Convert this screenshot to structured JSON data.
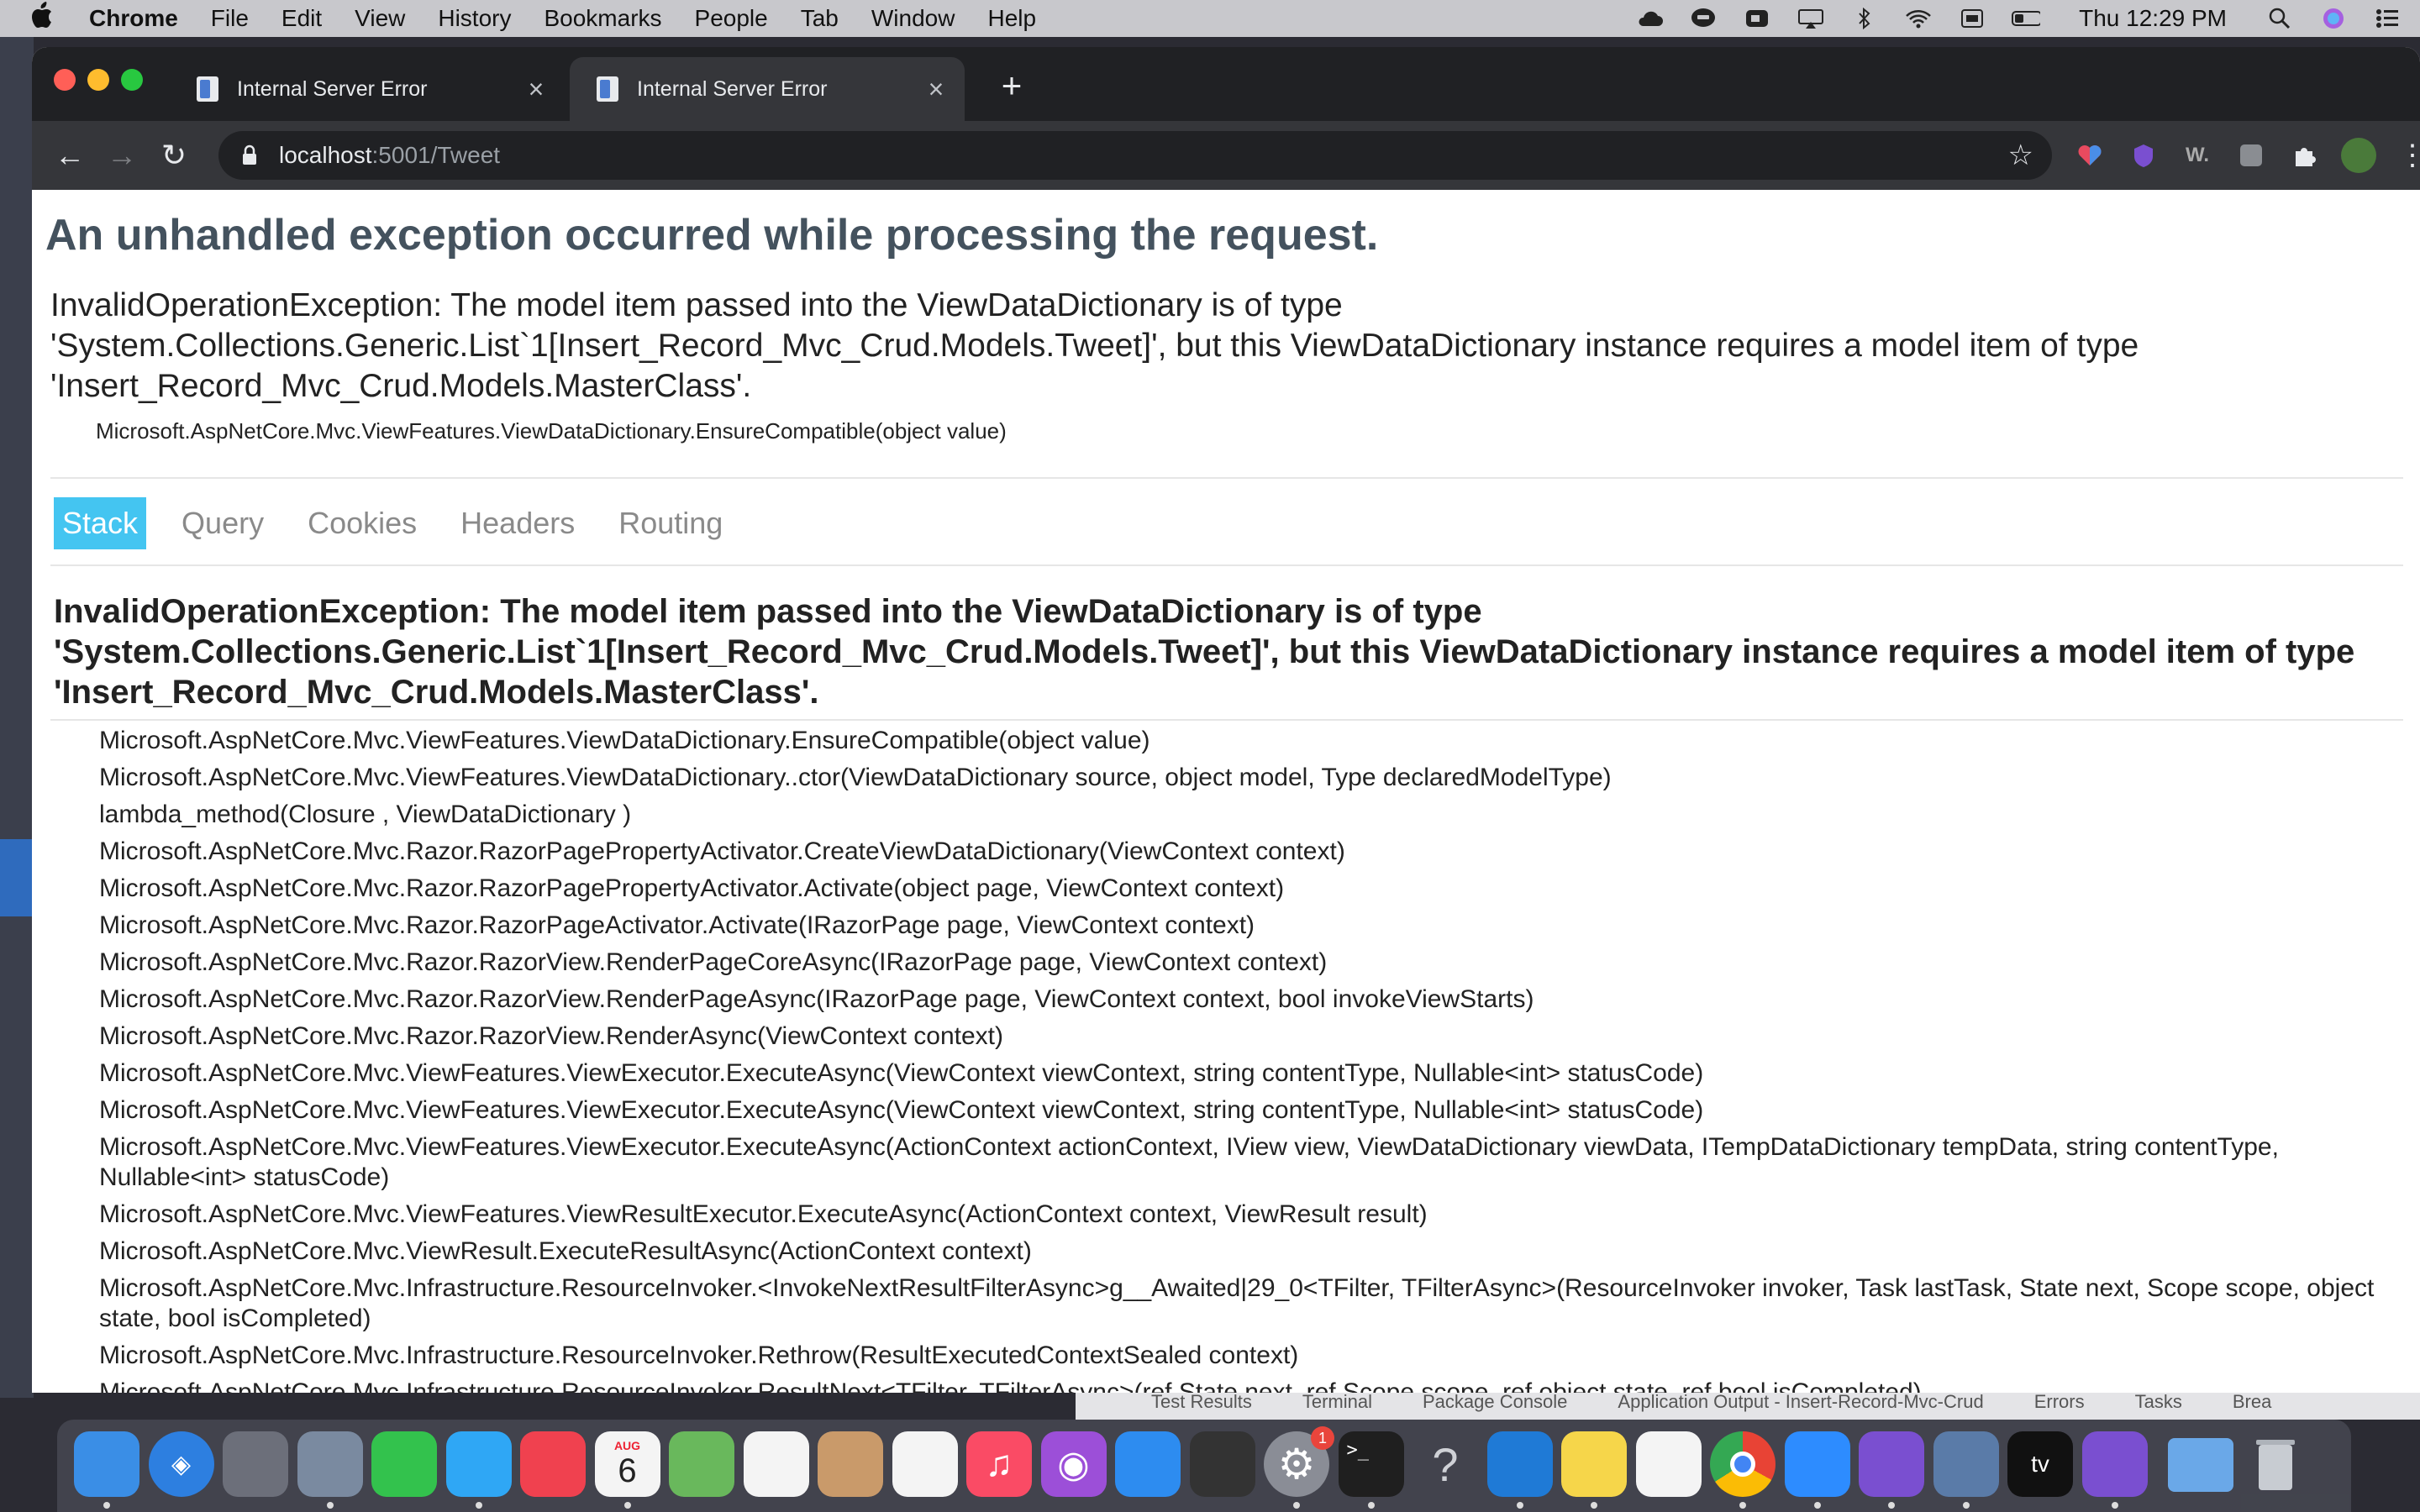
{
  "menubar": {
    "app_name": "Chrome",
    "items": [
      "File",
      "Edit",
      "View",
      "History",
      "Bookmarks",
      "People",
      "Tab",
      "Window",
      "Help"
    ],
    "clock": "Thu 12:29 PM"
  },
  "browser": {
    "tabs": [
      {
        "title": "Internal Server Error",
        "active": false
      },
      {
        "title": "Internal Server Error",
        "active": true
      }
    ],
    "url_host": "localhost",
    "url_rest": ":5001/Tweet"
  },
  "page": {
    "title": "An unhandled exception occurred while processing the request.",
    "summary": "InvalidOperationException: The model item passed into the ViewDataDictionary is of type 'System.Collections.Generic.List`1[Insert_Record_Mvc_Crud.Models.Tweet]', but this ViewDataDictionary instance requires a model item of type 'Insert_Record_Mvc_Crud.Models.MasterClass'.",
    "location": "Microsoft.AspNetCore.Mvc.ViewFeatures.ViewDataDictionary.EnsureCompatible(object value)",
    "tabs": [
      "Stack",
      "Query",
      "Cookies",
      "Headers",
      "Routing"
    ],
    "active_tab": "Stack",
    "stack_header": "InvalidOperationException: The model item passed into the ViewDataDictionary is of type 'System.Collections.Generic.List`1[Insert_Record_Mvc_Crud.Models.Tweet]', but this ViewDataDictionary instance requires a model item of type 'Insert_Record_Mvc_Crud.Models.MasterClass'.",
    "frames": [
      "Microsoft.AspNetCore.Mvc.ViewFeatures.ViewDataDictionary.EnsureCompatible(object value)",
      "Microsoft.AspNetCore.Mvc.ViewFeatures.ViewDataDictionary..ctor(ViewDataDictionary source, object model, Type declaredModelType)",
      "lambda_method(Closure , ViewDataDictionary )",
      "Microsoft.AspNetCore.Mvc.Razor.RazorPagePropertyActivator.CreateViewDataDictionary(ViewContext context)",
      "Microsoft.AspNetCore.Mvc.Razor.RazorPagePropertyActivator.Activate(object page, ViewContext context)",
      "Microsoft.AspNetCore.Mvc.Razor.RazorPageActivator.Activate(IRazorPage page, ViewContext context)",
      "Microsoft.AspNetCore.Mvc.Razor.RazorView.RenderPageCoreAsync(IRazorPage page, ViewContext context)",
      "Microsoft.AspNetCore.Mvc.Razor.RazorView.RenderPageAsync(IRazorPage page, ViewContext context, bool invokeViewStarts)",
      "Microsoft.AspNetCore.Mvc.Razor.RazorView.RenderAsync(ViewContext context)",
      "Microsoft.AspNetCore.Mvc.ViewFeatures.ViewExecutor.ExecuteAsync(ViewContext viewContext, string contentType, Nullable<int> statusCode)",
      "Microsoft.AspNetCore.Mvc.ViewFeatures.ViewExecutor.ExecuteAsync(ViewContext viewContext, string contentType, Nullable<int> statusCode)",
      "Microsoft.AspNetCore.Mvc.ViewFeatures.ViewExecutor.ExecuteAsync(ActionContext actionContext, IView view, ViewDataDictionary viewData, ITempDataDictionary tempData, string contentType, Nullable<int> statusCode)",
      "Microsoft.AspNetCore.Mvc.ViewFeatures.ViewResultExecutor.ExecuteAsync(ActionContext context, ViewResult result)",
      "Microsoft.AspNetCore.Mvc.ViewResult.ExecuteResultAsync(ActionContext context)",
      "Microsoft.AspNetCore.Mvc.Infrastructure.ResourceInvoker.<InvokeNextResultFilterAsync>g__Awaited|29_0<TFilter, TFilterAsync>(ResourceInvoker invoker, Task lastTask, State next, Scope scope, object state, bool isCompleted)",
      "Microsoft.AspNetCore.Mvc.Infrastructure.ResourceInvoker.Rethrow(ResultExecutedContextSealed context)",
      "Microsoft.AspNetCore.Mvc.Infrastructure.ResourceInvoker.ResultNext<TFilter, TFilterAsync>(ref State next, ref Scope scope, ref object state, ref bool isCompleted)"
    ]
  },
  "behind_window": {
    "bar_items": [
      "Test Results",
      "Terminal",
      "Package Console",
      "Application Output - Insert-Record-Mvc-Crud",
      "Errors",
      "Tasks",
      "Brea"
    ]
  },
  "dock": {
    "apps": [
      {
        "name": "finder-icon",
        "color": "#3a8ee6"
      },
      {
        "name": "safari-icon",
        "color": "#2d7fe0"
      },
      {
        "name": "launchpad-icon",
        "color": "#6c6f7a"
      },
      {
        "name": "preview-icon",
        "color": "#7a8aa0"
      },
      {
        "name": "facetime-icon",
        "color": "#33c24d"
      },
      {
        "name": "messages-icon",
        "color": "#2fa7f5"
      },
      {
        "name": "news-icon",
        "color": "#f0414f"
      },
      {
        "name": "calendar-icon",
        "color": "#f4f4f4"
      },
      {
        "name": "maps-icon",
        "color": "#69b85c"
      },
      {
        "name": "photos-icon",
        "color": "#f4f4f4"
      },
      {
        "name": "contacts-icon",
        "color": "#c99a6a"
      },
      {
        "name": "reminders-icon",
        "color": "#f4f4f4"
      },
      {
        "name": "music-icon",
        "color": "#fa4b65"
      },
      {
        "name": "podcasts-icon",
        "color": "#9c4fd8"
      },
      {
        "name": "app-store-icon",
        "color": "#2d8cf0"
      },
      {
        "name": "piano-icon",
        "color": "#333333"
      },
      {
        "name": "system-preferences-icon",
        "color": "#8a8d96"
      },
      {
        "name": "terminal-icon",
        "color": "#1f1f1f"
      },
      {
        "name": "help-icon",
        "color": "#5a5d68"
      },
      {
        "name": "vscode-icon",
        "color": "#1f7ad6"
      },
      {
        "name": "notes-icon",
        "color": "#f6d64a"
      },
      {
        "name": "slack-icon",
        "color": "#f4f4f4"
      },
      {
        "name": "chrome-icon",
        "color": "#f4f4f4"
      },
      {
        "name": "zoom-icon",
        "color": "#2d8cff"
      },
      {
        "name": "visual-studio-icon",
        "color": "#7a4fd0"
      },
      {
        "name": "mysql-workbench-icon",
        "color": "#5a7ba8"
      },
      {
        "name": "apple-tv-icon",
        "color": "#111111"
      },
      {
        "name": "visual-studio-2-icon",
        "color": "#7a4fd0"
      },
      {
        "name": "downloads-folder-icon",
        "color": "#6aa8e8"
      },
      {
        "name": "trash-icon",
        "color": "#c8ccd2"
      }
    ],
    "calendar_month": "AUG",
    "calendar_day": "6",
    "system_prefs_badge": "1"
  },
  "colors": {
    "active_tab_bg": "#44c5f1",
    "title_color": "#44525e",
    "chrome_dark": "#202124"
  }
}
